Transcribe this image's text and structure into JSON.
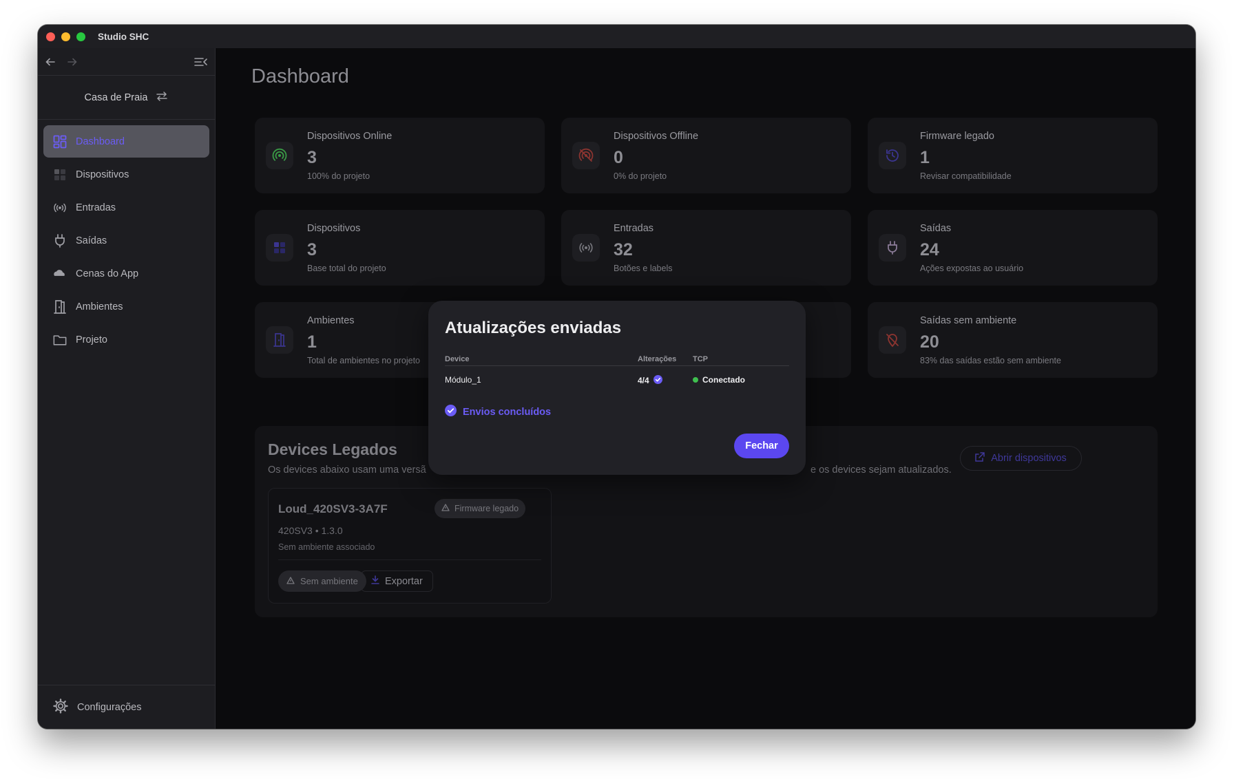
{
  "app": {
    "title": "Studio SHC"
  },
  "sidebar": {
    "project": "Casa de Praia",
    "items": [
      {
        "label": "Dashboard",
        "icon": "dashboard-icon",
        "active": true
      },
      {
        "label": "Dispositivos",
        "icon": "devices-icon"
      },
      {
        "label": "Entradas",
        "icon": "broadcast-icon"
      },
      {
        "label": "Saídas",
        "icon": "plug-icon"
      },
      {
        "label": "Cenas do App",
        "icon": "cloud-icon"
      },
      {
        "label": "Ambientes",
        "icon": "door-icon"
      },
      {
        "label": "Projeto",
        "icon": "folder-icon"
      }
    ],
    "settings": "Configurações"
  },
  "main": {
    "title": "Dashboard",
    "cards": [
      {
        "label": "Dispositivos Online",
        "value": "3",
        "sub": "100% do projeto",
        "icon": "signal-icon",
        "color": "#3a9c46"
      },
      {
        "label": "Dispositivos Offline",
        "value": "0",
        "sub": "0% do projeto",
        "icon": "signal-off-icon",
        "color": "#8c3430"
      },
      {
        "label": "Firmware legado",
        "value": "1",
        "sub": "Revisar compatibilidade",
        "icon": "history-icon",
        "color": "#3b3590"
      },
      {
        "label": "Dispositivos",
        "value": "3",
        "sub": "Base total do projeto",
        "icon": "devices-icon",
        "color": "#3b3590"
      },
      {
        "label": "Entradas",
        "value": "32",
        "sub": "Botões e labels",
        "icon": "broadcast-icon",
        "color": "#7a7a80"
      },
      {
        "label": "Saídas",
        "value": "24",
        "sub": "Ações expostas ao usuário",
        "icon": "plug-icon",
        "color": "#8d7d9a"
      },
      {
        "label": "Ambientes",
        "value": "1",
        "sub": "Total de ambientes no projeto",
        "icon": "door-icon",
        "color": "#3b3590"
      },
      {
        "label": "",
        "value": "",
        "sub": "",
        "icon": "",
        "color": ""
      },
      {
        "label": "Saídas sem ambiente",
        "value": "20",
        "sub": "83% das saídas estão sem ambiente",
        "icon": "location-off-icon",
        "color": "#8c3430"
      }
    ],
    "legacy": {
      "title": "Devices Legados",
      "desc_left": "Os devices abaixo usam uma versã",
      "desc_right": "e os devices sejam atualizados.",
      "open_button": "Abrir dispositivos",
      "device": {
        "name": "Loud_420SV3-3A7F",
        "badge": "Firmware legado",
        "model": "420SV3 • 1.3.0",
        "env": "Sem ambiente associado",
        "no_env_label": "Sem ambiente",
        "export_label": "Exportar"
      }
    }
  },
  "modal": {
    "title": "Atualizações enviadas",
    "columns": [
      "Device",
      "Alterações",
      "TCP"
    ],
    "rows": [
      {
        "device": "Módulo_1",
        "changes": "4/4",
        "tcp": "Conectado"
      }
    ],
    "status": "Envios concluídos",
    "close": "Fechar"
  }
}
